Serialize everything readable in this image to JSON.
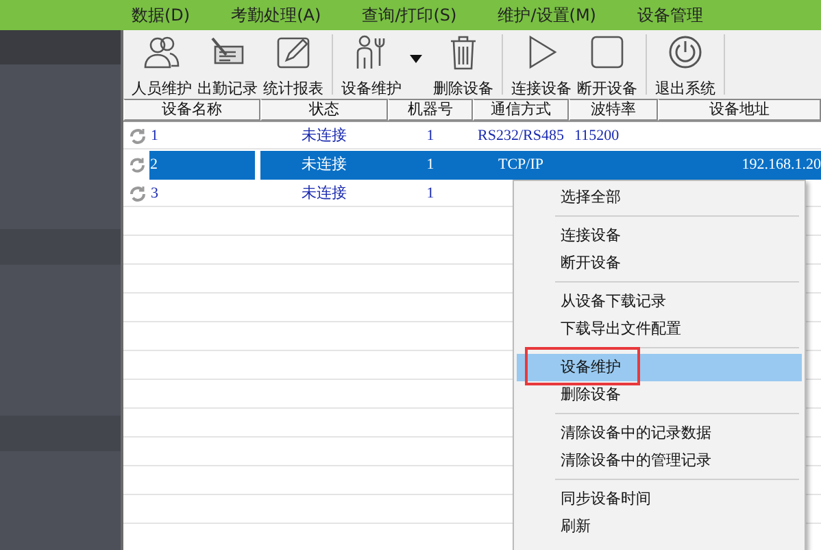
{
  "menu_bar": [
    {
      "label": "数据(D)"
    },
    {
      "label": "考勤处理(A)"
    },
    {
      "label": "查询/打印(S)"
    },
    {
      "label": "维护/设置(M)"
    },
    {
      "label": "设备管理"
    }
  ],
  "toolbar": [
    {
      "kind": "people",
      "label": "人员维护"
    },
    {
      "kind": "card",
      "label": "出勤记录"
    },
    {
      "kind": "pencil",
      "label": "统计报表",
      "sep": true
    },
    {
      "kind": "tools",
      "label": "设备维护",
      "dropdown": true
    },
    {
      "kind": "trash",
      "label": "删除设备",
      "sep": true
    },
    {
      "kind": "play",
      "label": "连接设备"
    },
    {
      "kind": "stop",
      "label": "断开设备",
      "sep": true
    },
    {
      "kind": "power",
      "label": "退出系统",
      "sep": true
    }
  ],
  "table": {
    "columns": [
      "设备名称",
      "状态",
      "机器号",
      "通信方式",
      "波特率",
      "设备地址"
    ],
    "rows": [
      {
        "selected": false,
        "cells": [
          "1",
          "未连接",
          "1",
          "RS232/RS485",
          "115200",
          ""
        ]
      },
      {
        "selected": true,
        "cells": [
          "2",
          "未连接",
          "1",
          "TCP/IP",
          "",
          "192.168.1.20"
        ]
      },
      {
        "selected": false,
        "cells": [
          "3",
          "未连接",
          "1",
          "",
          "",
          ""
        ]
      }
    ]
  },
  "context_menu": {
    "items": [
      {
        "kind": "item",
        "label": "选择全部",
        "selected": false
      },
      {
        "kind": "separator"
      },
      {
        "kind": "item",
        "label": "连接设备",
        "selected": false
      },
      {
        "kind": "item",
        "label": "断开设备",
        "selected": false
      },
      {
        "kind": "separator"
      },
      {
        "kind": "item",
        "label": "从设备下载记录",
        "selected": false
      },
      {
        "kind": "item",
        "label": "下载导出文件配置",
        "selected": false
      },
      {
        "kind": "separator"
      },
      {
        "kind": "item",
        "label": "设备维护",
        "selected": true,
        "marked": true
      },
      {
        "kind": "item",
        "label": "删除设备",
        "selected": false
      },
      {
        "kind": "separator"
      },
      {
        "kind": "item",
        "label": "清除设备中的记录数据",
        "selected": false
      },
      {
        "kind": "item",
        "label": "清除设备中的管理记录",
        "selected": false
      },
      {
        "kind": "separator"
      },
      {
        "kind": "item",
        "label": "同步设备时间",
        "selected": false
      },
      {
        "kind": "item",
        "label": "刷新",
        "selected": false
      }
    ]
  }
}
